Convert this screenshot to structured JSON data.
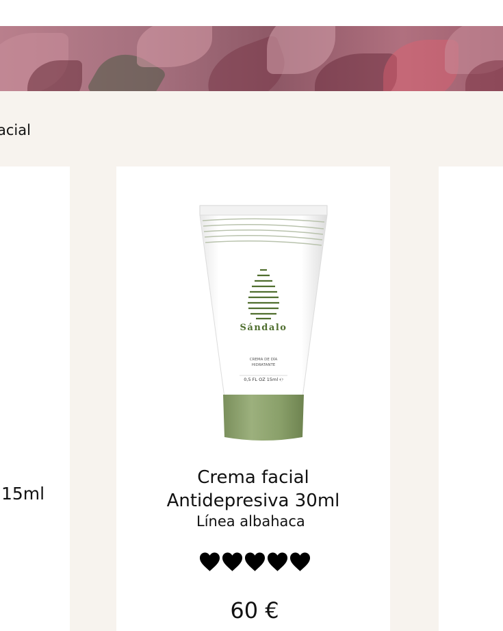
{
  "breadcrumb": {
    "current": "acial"
  },
  "left_card": {
    "size_label": "15ml"
  },
  "product": {
    "brand_label": "Sándalo",
    "tube_text_line1": "CREMA DE DÍA",
    "tube_text_line2": "HIDRATANTE",
    "tube_volume": "0,5 FL OZ   15ml ℮",
    "title_line1": "Crema facial",
    "title_line2": "Antidepresiva 30ml",
    "line": "Línea albahaca",
    "rating": 5,
    "price": "60 €"
  },
  "colors": {
    "section_bg": "#f7f3ee",
    "card_bg": "#ffffff",
    "tube_green": "#8aa06a",
    "brand_green": "#4f6e2e",
    "heart": "#000000"
  }
}
